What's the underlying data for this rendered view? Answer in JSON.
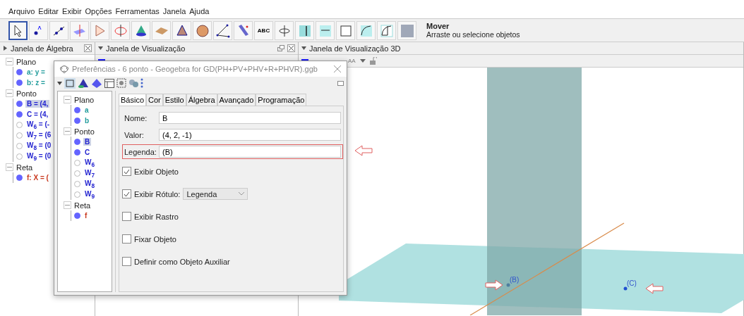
{
  "menu": [
    "Arquivo",
    "Editar",
    "Exibir",
    "Opções",
    "Ferramentas",
    "Janela",
    "Ajuda"
  ],
  "tools": [
    {
      "kind": "move",
      "selected": true
    },
    {
      "kind": "point",
      "selected": false
    },
    {
      "kind": "line",
      "selected": false
    },
    {
      "kind": "perpendicular",
      "selected": false
    },
    {
      "kind": "polygon",
      "selected": false
    },
    {
      "kind": "circle",
      "selected": false
    },
    {
      "kind": "cone",
      "selected": false
    },
    {
      "kind": "plane",
      "selected": false
    },
    {
      "kind": "pyramid",
      "selected": false
    },
    {
      "kind": "sphere",
      "selected": false
    },
    {
      "kind": "angle",
      "selected": false
    },
    {
      "kind": "reflect",
      "selected": false
    },
    {
      "kind": "text",
      "label": "ABC",
      "selected": false
    },
    {
      "kind": "rotate",
      "selected": false
    },
    {
      "kind": "view-v",
      "selected": false
    },
    {
      "kind": "view-h",
      "selected": false
    },
    {
      "kind": "view-square",
      "selected": false
    },
    {
      "kind": "view-arc",
      "selected": false
    },
    {
      "kind": "view-arc2",
      "selected": false
    },
    {
      "kind": "grid",
      "selected": false
    }
  ],
  "tool_help": {
    "title": "Mover",
    "text": "Arraste ou selecione objetos"
  },
  "panels": [
    {
      "title": "Janela de Álgebra",
      "expanded": false
    },
    {
      "title": "Janela de Visualização",
      "expanded": true
    },
    {
      "title": "Janela de Visualização 3D",
      "expanded": true
    }
  ],
  "algebra": [
    {
      "label": "Plano",
      "children": [
        {
          "label": "a: y =",
          "visible": true,
          "selected": false,
          "color": "#1f9b9b"
        },
        {
          "label": "b: z =",
          "visible": true,
          "selected": false,
          "color": "#1f9b9b"
        }
      ]
    },
    {
      "label": "Ponto",
      "children": [
        {
          "label": "B = (4,",
          "visible": true,
          "selected": true,
          "color": "#2323d0"
        },
        {
          "label": "C = (4,",
          "visible": true,
          "selected": false,
          "color": "#2323d0"
        },
        {
          "label": "W$_{6}$ = (-",
          "visible": false,
          "selected": false,
          "color": "#2323d0"
        },
        {
          "label": "W$_{7}$ = (6",
          "visible": false,
          "selected": false,
          "color": "#2323d0"
        },
        {
          "label": "W$_{8}$ = (0",
          "visible": false,
          "selected": false,
          "color": "#2323d0"
        },
        {
          "label": "W$_{9}$ = (0",
          "visible": false,
          "selected": false,
          "color": "#2323d0"
        }
      ]
    },
    {
      "label": "Reta",
      "children": [
        {
          "label": "f: X = (",
          "visible": true,
          "selected": false,
          "color": "#c8361c"
        }
      ]
    }
  ],
  "view3d_toolbar": {
    "font_button": "AA"
  },
  "view3d": {
    "points": [
      {
        "label": "(B)",
        "selected": true
      },
      {
        "label": "(C)",
        "selected": false
      }
    ]
  },
  "dialog": {
    "title": "Preferências - 6 ponto - Geogebra for GD(PH+PV+PHV+R+PHVR).ggb",
    "tree": [
      {
        "label": "Plano",
        "children": [
          {
            "label": "a",
            "visible": true,
            "selected": false,
            "color": "#1f9b9b"
          },
          {
            "label": "b",
            "visible": true,
            "selected": false,
            "color": "#1f9b9b"
          }
        ]
      },
      {
        "label": "Ponto",
        "children": [
          {
            "label": "B",
            "visible": true,
            "selected": true,
            "color": "#2323d0"
          },
          {
            "label": "C",
            "visible": true,
            "selected": false,
            "color": "#2323d0"
          },
          {
            "label": "W$_{6}$",
            "visible": false,
            "selected": false,
            "color": "#2323d0"
          },
          {
            "label": "W$_{7}$",
            "visible": false,
            "selected": false,
            "color": "#2323d0"
          },
          {
            "label": "W$_{8}$",
            "visible": false,
            "selected": false,
            "color": "#2323d0"
          },
          {
            "label": "W$_{9}$",
            "visible": false,
            "selected": false,
            "color": "#2323d0"
          }
        ]
      },
      {
        "label": "Reta",
        "children": [
          {
            "label": "f",
            "visible": true,
            "selected": false,
            "color": "#c8361c"
          }
        ]
      }
    ],
    "tabs": [
      {
        "label": "Básico",
        "selected": true
      },
      {
        "label": "Cor",
        "selected": false
      },
      {
        "label": "Estilo",
        "selected": false
      },
      {
        "label": "Álgebra",
        "selected": false
      },
      {
        "label": "Avançado",
        "selected": false
      },
      {
        "label": "Programação",
        "selected": false
      }
    ],
    "fields": [
      {
        "label": "Nome:",
        "value": "B"
      },
      {
        "label": "Valor:",
        "value": "(4, 2, -1)"
      },
      {
        "label": "Legenda:",
        "value": "(B)",
        "highlighted": true
      }
    ],
    "options": [
      {
        "label": "Exibir Objeto",
        "checked": true
      },
      {
        "label": "Exibir Rótulo:",
        "checked": true,
        "select": "Legenda"
      },
      {
        "label": "Exibir Rastro",
        "checked": false
      },
      {
        "label": "Fixar Objeto",
        "checked": false
      },
      {
        "label": "Definir como Objeto Auxiliar",
        "checked": false
      }
    ]
  }
}
